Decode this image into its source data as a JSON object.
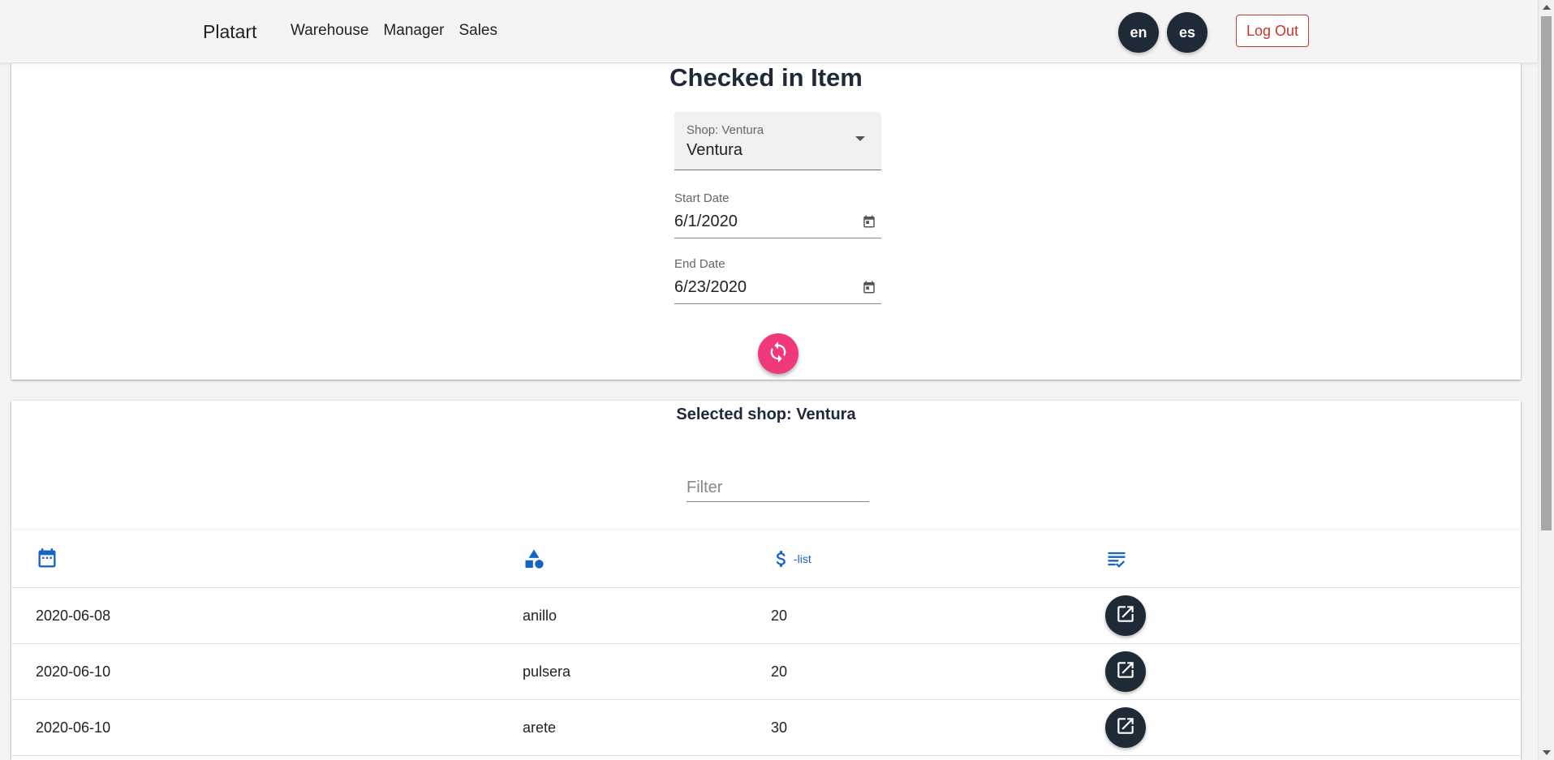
{
  "nav": {
    "brand": "Platart",
    "links": [
      "Warehouse",
      "Manager",
      "Sales"
    ],
    "lang_en": "en",
    "lang_es": "es",
    "logout": "Log Out"
  },
  "form": {
    "title": "Checked in Item",
    "shop_label": "Shop: Ventura",
    "shop_value": "Ventura",
    "start_label": "Start Date",
    "start_value": "6/1/2020",
    "end_label": "End Date",
    "end_value": "6/23/2020"
  },
  "results": {
    "heading": "Selected shop: Ventura",
    "filter_placeholder": "Filter",
    "filter_value": "",
    "price_header_suffix": "-list",
    "rows": [
      {
        "date": "2020-06-08",
        "item": "anillo",
        "price": "20"
      },
      {
        "date": "2020-06-10",
        "item": "pulsera",
        "price": "20"
      },
      {
        "date": "2020-06-10",
        "item": "arete",
        "price": "30"
      }
    ]
  },
  "colors": {
    "accent_pink": "#f0387c",
    "dark_button": "#1f2a37",
    "logout_red": "#c0392b",
    "icon_blue": "#1565c0"
  },
  "icons": {
    "header_date": "calendar-icon",
    "header_item": "shapes-icon",
    "header_price": "dollar-icon",
    "header_detail": "checklist-icon",
    "row_action": "open-in-new-icon",
    "refresh": "refresh-icon"
  }
}
